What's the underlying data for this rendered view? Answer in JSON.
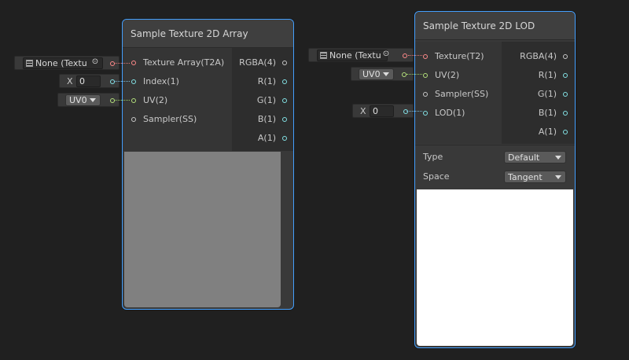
{
  "nodes": {
    "array": {
      "title": "Sample Texture 2D Array",
      "inputs": [
        {
          "label": "Texture Array(T2A)",
          "color": "#ff8a8a"
        },
        {
          "label": "Index(1)",
          "color": "#84e4e7"
        },
        {
          "label": "UV(2)",
          "color": "#b4e07c"
        },
        {
          "label": "Sampler(SS)",
          "color": "#c8c8c8"
        }
      ],
      "outputs": [
        "RGBA(4)",
        "R(1)",
        "G(1)",
        "B(1)",
        "A(1)"
      ]
    },
    "lod": {
      "title": "Sample Texture 2D LOD",
      "inputs": [
        {
          "label": "Texture(T2)",
          "color": "#ff8a8a"
        },
        {
          "label": "UV(2)",
          "color": "#b4e07c"
        },
        {
          "label": "Sampler(SS)",
          "color": "#c8c8c8"
        },
        {
          "label": "LOD(1)",
          "color": "#84e4e7"
        }
      ],
      "outputs": [
        "RGBA(4)",
        "R(1)",
        "G(1)",
        "B(1)",
        "A(1)"
      ],
      "settings": {
        "type_label": "Type",
        "type_value": "Default",
        "space_label": "Space",
        "space_value": "Tangent"
      }
    }
  },
  "inline_controls": {
    "array_texture": "None (Textu",
    "array_index_axis": "X",
    "array_index_value": "0",
    "array_uv": "UV0",
    "lod_texture": "None (Textu",
    "lod_uv": "UV0",
    "lod_axis": "X",
    "lod_value": "0"
  },
  "colors": {
    "selection": "#44a0ff",
    "texture_port": "#ff8a8a",
    "vector1_port": "#84e4e7",
    "vector2_port": "#b4e07c",
    "background": "#202020"
  }
}
